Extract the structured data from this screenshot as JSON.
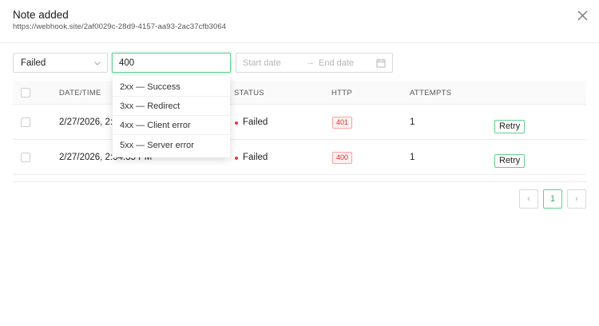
{
  "header": {
    "title": "Note added",
    "url": "https://webhook.site/2af0029c-28d9-4157-aa93-2ac37cfb3064",
    "close_icon": "close-icon"
  },
  "filters": {
    "status_value": "Failed",
    "search_value": "400",
    "date_start_placeholder": "Start date",
    "date_arrow": "→",
    "date_end_placeholder": "End date"
  },
  "dropdown": {
    "options": [
      "2xx — Success",
      "3xx — Redirect",
      "4xx — Client error",
      "5xx — Server error"
    ]
  },
  "table": {
    "columns": [
      "DATE/TIME",
      "STATUS",
      "HTTP",
      "ATTEMPTS"
    ],
    "rows": [
      {
        "datetime": "2/27/2026, 2:",
        "status": "Failed",
        "http": "401",
        "attempts": "1",
        "action": "Retry"
      },
      {
        "datetime": "2/27/2026, 2:34:35 PM",
        "status": "Failed",
        "http": "400",
        "attempts": "1",
        "action": "Retry"
      }
    ]
  },
  "pagination": {
    "prev": "‹",
    "current": "1",
    "next": "›"
  },
  "colors": {
    "accent": "#5fcf8f",
    "error": "#e53935"
  }
}
